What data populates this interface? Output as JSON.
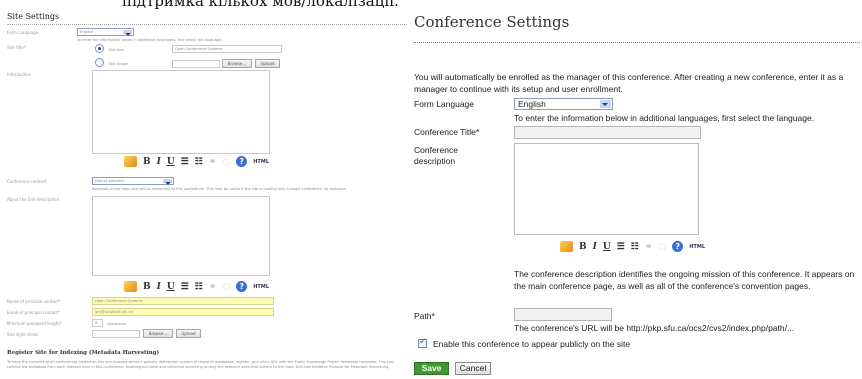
{
  "overlay_text": "підтримка кількох мов/локалізації.",
  "left": {
    "title": "Site Settings",
    "form_language_label": "Form Language",
    "form_language_value": "English",
    "form_language_note": "To enter the information below in additional languages, first select the language.",
    "site_title_label": "Site title*",
    "title_text_option": "Title text",
    "title_text_value": "Open Conference Systems",
    "title_image_option": "Title image",
    "browse_label": "Browse...",
    "upload_label": "Upload",
    "introduction_label": "Introduction",
    "conference_redirect_label": "Conference redirect",
    "conference_redirect_value": "(None) selected",
    "conference_redirect_note": "Requests to the main site will be redirected to this conference. This may be useful if the site is hosting only a single conference, for example.",
    "about_label": "About the Site description",
    "principal_name_label": "Name of principal contact*",
    "principal_name_value": "Open Conference Systems",
    "principal_email_label": "Email of principal contact*",
    "principal_email_value": "ocs@localhost.sfu.ca",
    "min_password_label": "Minimum password length*",
    "min_password_value": "6",
    "min_password_unit": "characters",
    "stylesheet_label": "Site style sheet",
    "indexing_title": "Register Site for Indexing (Metadata Harvesting)",
    "indexing_text": "To have the contents of all conferences hosted on this site indexed within a globally distributed system of research databases, register your site's URL with the Public Knowledge Project metadata harvester. This tool collects the metadata from each indexed item in this conference, enabling accurate and collective searching among the research sites that adhere to the Open Archives Initiative Protocol for Metadata Harvesting."
  },
  "right": {
    "title": "Conference Settings",
    "intro": "You will automatically be enrolled as the manager of this conference. After creating a new conference, enter it as a manager to continue with its setup and user enrollment.",
    "form_language_label": "Form Language",
    "form_language_value": "English",
    "form_language_note": "To enter the information below in additional languages, first select the language.",
    "conference_title_label": "Conference Title*",
    "conference_description_label": "Conference description",
    "description_note": "The conference description identifies the ongoing mission of this conference. It appears on the main conference page, as well as all of the conference's convention pages.",
    "path_label": "Path*",
    "path_note": "The conference's URL will be http://pkp.sfu.ca/ocs2/cvs2/index.php/path/...",
    "enable_label": "Enable this conference to appear publicly on the site",
    "enable_checked": true,
    "save_label": "Save",
    "cancel_label": "Cancel"
  },
  "toolbar": {
    "bold": "B",
    "italic": "I",
    "underline": "U",
    "html": "HTML"
  }
}
